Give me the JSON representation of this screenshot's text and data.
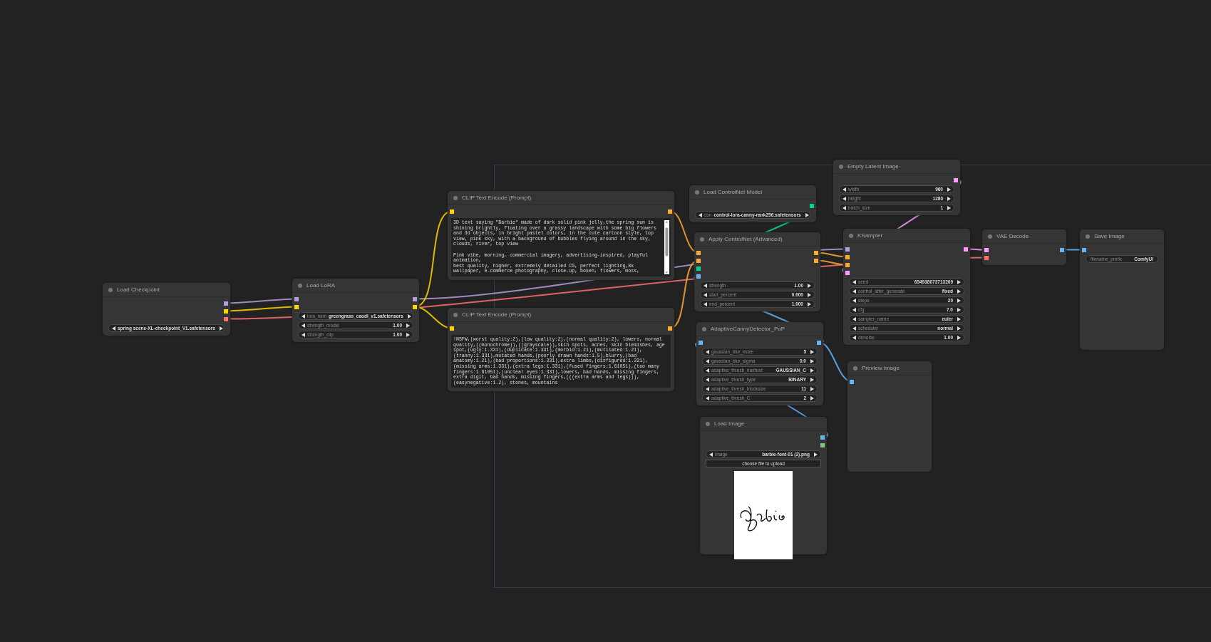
{
  "nodes": [
    {
      "title": "Load Checkpoint",
      "outputs": [
        {
          "color": "#b39ddb"
        },
        {
          "color": "#ffd500"
        },
        {
          "color": "#ff6e6e"
        }
      ],
      "widgets": [
        {
          "kind": "combo",
          "value": "spring scene-XL-checkpoint_V1.safetensors"
        }
      ]
    },
    {
      "title": "Load LoRA",
      "inputs": [
        {
          "color": "#b39ddb"
        },
        {
          "color": "#ffd500"
        }
      ],
      "outputs": [
        {
          "color": "#b39ddb"
        },
        {
          "color": "#ffd500"
        }
      ],
      "widgets": [
        {
          "kind": "combo",
          "label": "lora_nam",
          "value": "greengrass_caodi_v1.safetensors"
        },
        {
          "kind": "number",
          "label": "strength_model",
          "value": "1.00"
        },
        {
          "kind": "number",
          "label": "strength_clip",
          "value": "1.00"
        }
      ]
    },
    {
      "title": "CLIP Text Encode (Prompt)",
      "inputs": [
        {
          "color": "#ffd500"
        }
      ],
      "outputs": [
        {
          "color": "#ffa931"
        }
      ],
      "widgets": [
        {
          "kind": "textarea",
          "scrollbar": true,
          "text": "3D text saying \"Barbie\" made of dark solid pink jelly,the spring sun is shining brightly, floating over a grassy landscape with some big flowers and 3d objects, in bright pastel colors, in the cute cartoon style, top view, pink sky, with a background of bubbles flying around in the sky, clouds, river, top view\n\nPink vibe, morning, commercial imagery, advertising-inspired, playful animation,\nbest quality, higher, extremely detailed CG, perfect lighting,8k wallpaper, e-commerce photography, close-up, bokeh, flowers, moss,"
        }
      ]
    },
    {
      "title": "CLIP Text Encode (Prompt)",
      "inputs": [
        {
          "color": "#ffd500"
        }
      ],
      "outputs": [
        {
          "color": "#ffa931"
        }
      ],
      "widgets": [
        {
          "kind": "textarea",
          "scrollbar": false,
          "text": "!NSFW,(worst quality:2),(low quality:2),(normal quality:2), lowers, normal quality,((monochrome)),((grayscale)),skin spots, acnes, skin blemishes, age spot,(ugly:1.331),(duplicate:1.331),(morbid:1.21),(mutilated:1.21),(tranny:1.331),mutated hands,(poorly drawn hands:1.5),blurry,(bad anatomy:1.21),(bad proportions:1.331),extra limbs,(disfigured:1.331),(missing arms:1.331),(extra legs:1.331),(fused fingers:1.61051),(too many fingers:1.61051),(unclear eyes:1.331),lowers, bad hands, missing fingers, extra digit, bad hands, missing fingers,(((extra arms and legs))),(easynegative:1.2), stones, mountains"
        }
      ]
    },
    {
      "title": "Load ControlNet Model",
      "outputs": [
        {
          "color": "#00d78d"
        }
      ],
      "widgets": [
        {
          "kind": "combo",
          "label": "con",
          "value": "control-lora-canny-rank256.safetensors"
        }
      ]
    },
    {
      "title": "Apply ControlNet (Advanced)",
      "inputs": [
        {
          "color": "#ffa931"
        },
        {
          "color": "#ffa931"
        },
        {
          "color": "#00d78d"
        },
        {
          "color": "#64b5f6"
        }
      ],
      "outputs": [
        {
          "color": "#ffa931"
        },
        {
          "color": "#ffa931"
        }
      ],
      "widgets": [
        {
          "kind": "number",
          "label": "strength",
          "value": "1.00"
        },
        {
          "kind": "number",
          "label": "start_percent",
          "value": "0.000"
        },
        {
          "kind": "number",
          "label": "end_percent",
          "value": "1.000"
        }
      ]
    },
    {
      "title": "AdaptiveCannyDetector_PoP",
      "inputs": [
        {
          "color": "#64b5f6"
        }
      ],
      "outputs": [
        {
          "color": "#64b5f6"
        }
      ],
      "widgets": [
        {
          "kind": "number",
          "label": "gaussian_blur_ksize",
          "value": "5"
        },
        {
          "kind": "number",
          "label": "gaussian_blur_sigma",
          "value": "0.0"
        },
        {
          "kind": "combo",
          "label": "adaptive_thresh_method",
          "value": "GAUSSIAN_C"
        },
        {
          "kind": "combo",
          "label": "adaptive_thresh_type",
          "value": "BINARY"
        },
        {
          "kind": "number",
          "label": "adaptive_thresh_blocksize",
          "value": "11"
        },
        {
          "kind": "number",
          "label": "adaptive_thresh_C",
          "value": "2"
        }
      ]
    },
    {
      "title": "Load Image",
      "outputs": [
        {
          "color": "#64b5f6"
        },
        {
          "color": "#81c784"
        }
      ],
      "widgets": [
        {
          "kind": "combo",
          "label": "image",
          "value": "barbie-font-01 (2).png"
        },
        {
          "kind": "button",
          "label": "choose file to upload"
        },
        {
          "kind": "picture"
        }
      ]
    },
    {
      "title": "Empty Latent Image",
      "outputs": [
        {
          "color": "#ff9cf9"
        }
      ],
      "widgets": [
        {
          "kind": "number",
          "label": "width",
          "value": "960"
        },
        {
          "kind": "number",
          "label": "height",
          "value": "1280"
        },
        {
          "kind": "number",
          "label": "batch_size",
          "value": "1"
        }
      ]
    },
    {
      "title": "KSampler",
      "inputs": [
        {
          "color": "#b39ddb"
        },
        {
          "color": "#ffa931"
        },
        {
          "color": "#ffa931"
        },
        {
          "color": "#ff9cf9"
        }
      ],
      "outputs": [
        {
          "color": "#ff9cf9"
        }
      ],
      "widgets": [
        {
          "kind": "number",
          "label": "seed",
          "value": "654938073713269"
        },
        {
          "kind": "combo",
          "label": "control_after_generate",
          "value": "fixed"
        },
        {
          "kind": "number",
          "label": "steps",
          "value": "20"
        },
        {
          "kind": "number",
          "label": "cfg",
          "value": "7.0"
        },
        {
          "kind": "combo",
          "label": "sampler_name",
          "value": "euler"
        },
        {
          "kind": "combo",
          "label": "scheduler",
          "value": "normal"
        },
        {
          "kind": "number",
          "label": "denoise",
          "value": "1.00"
        }
      ]
    },
    {
      "title": "Preview Image",
      "inputs": [
        {
          "color": "#64b5f6"
        }
      ]
    },
    {
      "title": "VAE Decode",
      "inputs": [
        {
          "color": "#ff9cf9"
        },
        {
          "color": "#ff6e6e"
        }
      ],
      "outputs": [
        {
          "color": "#64b5f6"
        }
      ]
    },
    {
      "title": "Save Image",
      "inputs": [
        {
          "color": "#64b5f6"
        }
      ],
      "widgets": [
        {
          "kind": "text",
          "label": "filename_prefix",
          "value": "ComfyUI"
        }
      ]
    }
  ]
}
